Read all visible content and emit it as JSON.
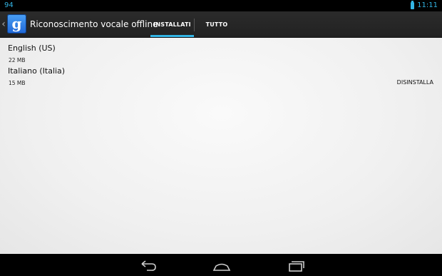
{
  "status_bar": {
    "notification": "94",
    "time": "11:11"
  },
  "action_bar": {
    "icon_letter": "g",
    "title": "Riconoscimento vocale offline",
    "tabs": [
      {
        "label": "INSTALLATI",
        "selected": true
      },
      {
        "label": "TUTTO",
        "selected": false
      }
    ]
  },
  "languages": [
    {
      "name": "English (US)",
      "size": "22 MB",
      "action": ""
    },
    {
      "name": "Italiano (Italia)",
      "size": "15 MB",
      "action": "DISINSTALLA"
    }
  ],
  "colors": {
    "accent": "#33b5e5",
    "action_bar": "#252525",
    "content_bg": "#f2f2f2"
  },
  "nav_bar": {
    "icons": [
      "back-icon",
      "home-icon",
      "recent-apps-icon"
    ]
  }
}
